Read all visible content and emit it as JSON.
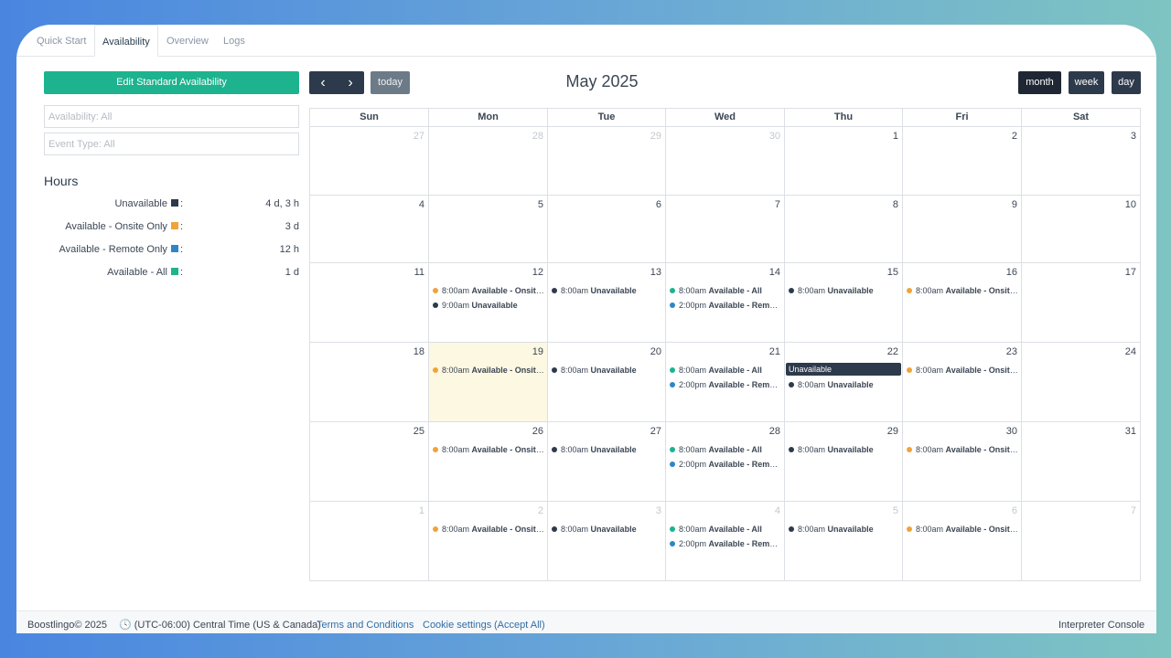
{
  "tabs": [
    "Quick Start",
    "Availability",
    "Overview",
    "Logs"
  ],
  "sidebar": {
    "edit_button": "Edit Standard Availability",
    "availability_filter": "Availability: All",
    "event_type_filter": "Event Type: All",
    "hours_title": "Hours",
    "hours": [
      {
        "label": "Unavailable",
        "color": "#2d3a4b",
        "value": "4 d, 3 h"
      },
      {
        "label": "Available - Onsite Only",
        "color": "#f0a33a",
        "value": "3 d"
      },
      {
        "label": "Available - Remote Only",
        "color": "#2e86c8",
        "value": "12 h"
      },
      {
        "label": "Available - All",
        "color": "#1cb38e",
        "value": "1 d"
      }
    ]
  },
  "toolbar": {
    "prev": "‹",
    "next": "›",
    "today": "today",
    "title": "May 2025",
    "views": [
      "month",
      "week",
      "day"
    ],
    "active_view": "month"
  },
  "calendar": {
    "weekdays": [
      "Sun",
      "Mon",
      "Tue",
      "Wed",
      "Thu",
      "Fri",
      "Sat"
    ],
    "weeks": [
      [
        {
          "d": "27",
          "o": true
        },
        {
          "d": "28",
          "o": true
        },
        {
          "d": "29",
          "o": true
        },
        {
          "d": "30",
          "o": true
        },
        {
          "d": "1"
        },
        {
          "d": "2"
        },
        {
          "d": "3"
        }
      ],
      [
        {
          "d": "4"
        },
        {
          "d": "5"
        },
        {
          "d": "6"
        },
        {
          "d": "7"
        },
        {
          "d": "8"
        },
        {
          "d": "9"
        },
        {
          "d": "10"
        }
      ],
      [
        {
          "d": "11"
        },
        {
          "d": "12",
          "ev": [
            {
              "t": "8:00am",
              "n": "Available - Onsite Only",
              "c": "#f0a33a"
            },
            {
              "t": "9:00am",
              "n": "Unavailable",
              "c": "#2d3a4b"
            }
          ]
        },
        {
          "d": "13",
          "ev": [
            {
              "t": "8:00am",
              "n": "Unavailable",
              "c": "#2d3a4b"
            }
          ]
        },
        {
          "d": "14",
          "ev": [
            {
              "t": "8:00am",
              "n": "Available - All",
              "c": "#1cb38e"
            },
            {
              "t": "2:00pm",
              "n": "Available - Remote Only",
              "c": "#2e86c8"
            }
          ]
        },
        {
          "d": "15",
          "ev": [
            {
              "t": "8:00am",
              "n": "Unavailable",
              "c": "#2d3a4b"
            }
          ]
        },
        {
          "d": "16",
          "ev": [
            {
              "t": "8:00am",
              "n": "Available - Onsite Only",
              "c": "#f0a33a"
            }
          ]
        },
        {
          "d": "17"
        }
      ],
      [
        {
          "d": "18"
        },
        {
          "d": "19",
          "today": true,
          "ev": [
            {
              "t": "8:00am",
              "n": "Available - Onsite Only",
              "c": "#f0a33a"
            }
          ]
        },
        {
          "d": "20",
          "ev": [
            {
              "t": "8:00am",
              "n": "Unavailable",
              "c": "#2d3a4b"
            }
          ]
        },
        {
          "d": "21",
          "ev": [
            {
              "t": "8:00am",
              "n": "Available - All",
              "c": "#1cb38e"
            },
            {
              "t": "2:00pm",
              "n": "Available - Remote Only",
              "c": "#2e86c8"
            }
          ]
        },
        {
          "d": "22",
          "ev": [
            {
              "block": true,
              "n": "Unavailable"
            },
            {
              "t": "8:00am",
              "n": "Unavailable",
              "c": "#2d3a4b"
            }
          ]
        },
        {
          "d": "23",
          "ev": [
            {
              "t": "8:00am",
              "n": "Available - Onsite Only",
              "c": "#f0a33a"
            }
          ]
        },
        {
          "d": "24"
        }
      ],
      [
        {
          "d": "25"
        },
        {
          "d": "26",
          "ev": [
            {
              "t": "8:00am",
              "n": "Available - Onsite Only",
              "c": "#f0a33a"
            }
          ]
        },
        {
          "d": "27",
          "ev": [
            {
              "t": "8:00am",
              "n": "Unavailable",
              "c": "#2d3a4b"
            }
          ]
        },
        {
          "d": "28",
          "ev": [
            {
              "t": "8:00am",
              "n": "Available - All",
              "c": "#1cb38e"
            },
            {
              "t": "2:00pm",
              "n": "Available - Remote Only",
              "c": "#2e86c8"
            }
          ]
        },
        {
          "d": "29",
          "ev": [
            {
              "t": "8:00am",
              "n": "Unavailable",
              "c": "#2d3a4b"
            }
          ]
        },
        {
          "d": "30",
          "ev": [
            {
              "t": "8:00am",
              "n": "Available - Onsite Only",
              "c": "#f0a33a"
            }
          ]
        },
        {
          "d": "31"
        }
      ],
      [
        {
          "d": "1",
          "o": true
        },
        {
          "d": "2",
          "o": true,
          "ev": [
            {
              "t": "8:00am",
              "n": "Available - Onsite Only",
              "c": "#f0a33a"
            }
          ]
        },
        {
          "d": "3",
          "o": true,
          "ev": [
            {
              "t": "8:00am",
              "n": "Unavailable",
              "c": "#2d3a4b"
            }
          ]
        },
        {
          "d": "4",
          "o": true,
          "ev": [
            {
              "t": "8:00am",
              "n": "Available - All",
              "c": "#1cb38e"
            },
            {
              "t": "2:00pm",
              "n": "Available - Remote Only",
              "c": "#2e86c8"
            }
          ]
        },
        {
          "d": "5",
          "o": true,
          "ev": [
            {
              "t": "8:00am",
              "n": "Unavailable",
              "c": "#2d3a4b"
            }
          ]
        },
        {
          "d": "6",
          "o": true,
          "ev": [
            {
              "t": "8:00am",
              "n": "Available - Onsite Only",
              "c": "#f0a33a"
            }
          ]
        },
        {
          "d": "7",
          "o": true
        }
      ]
    ]
  },
  "footer": {
    "brand": "Boostlingo© 2025",
    "timezone": "(UTC-06:00) Central Time (US & Canada)",
    "terms": "Terms and Conditions",
    "cookies": "Cookie settings",
    "accept": "(Accept All)",
    "console": "Interpreter Console"
  }
}
